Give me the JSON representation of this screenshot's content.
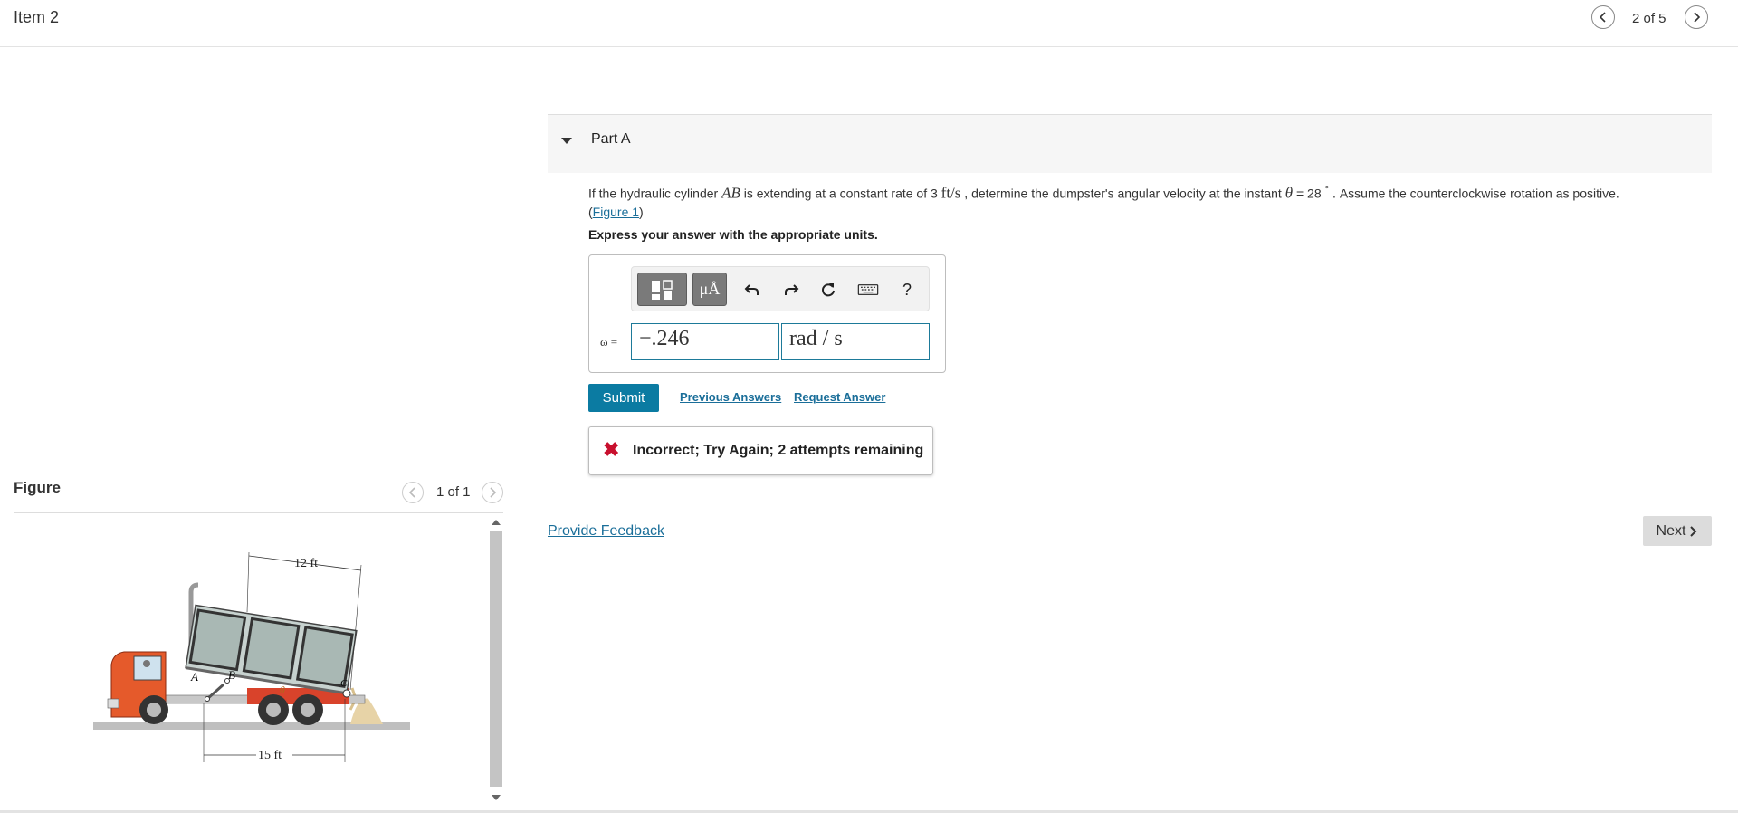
{
  "header": {
    "title": "Item 2",
    "pager": "2 of 5"
  },
  "figure": {
    "title": "Figure",
    "pager": "1 of 1",
    "labels": {
      "dim_top": "12 ft",
      "dim_bottom": "15 ft",
      "point_a": "A",
      "point_b": "B",
      "point_c": "C",
      "angle": "θ"
    }
  },
  "part": {
    "label": "Part A"
  },
  "question": {
    "t1": "If the hydraulic cylinder ",
    "m_ab": "AB",
    "t2": " is extending at a constant rate of 3 ",
    "m_unit": "ft/s",
    "t3": " , determine the dumpster's angular velocity at the instant ",
    "m_theta": "θ",
    "t4": " = 28 ",
    "deg": "°",
    "t5": " . Assume the counterclockwise rotation as positive.",
    "fig_open": "(",
    "fig_link": "Figure 1",
    "fig_close": ")"
  },
  "express": "Express your answer with the appropriate units.",
  "toolbar": {
    "units_btn": "μÅ",
    "help": "?"
  },
  "answer": {
    "label": "ω =",
    "value": "−.246",
    "units": "rad / s"
  },
  "actions": {
    "submit": "Submit",
    "previous_answers": "Previous Answers",
    "request_answer": "Request Answer"
  },
  "feedback": {
    "icon": "✖",
    "text": "Incorrect; Try Again; 2 attempts remaining"
  },
  "footer": {
    "provide_feedback": "Provide Feedback",
    "next": "Next"
  }
}
